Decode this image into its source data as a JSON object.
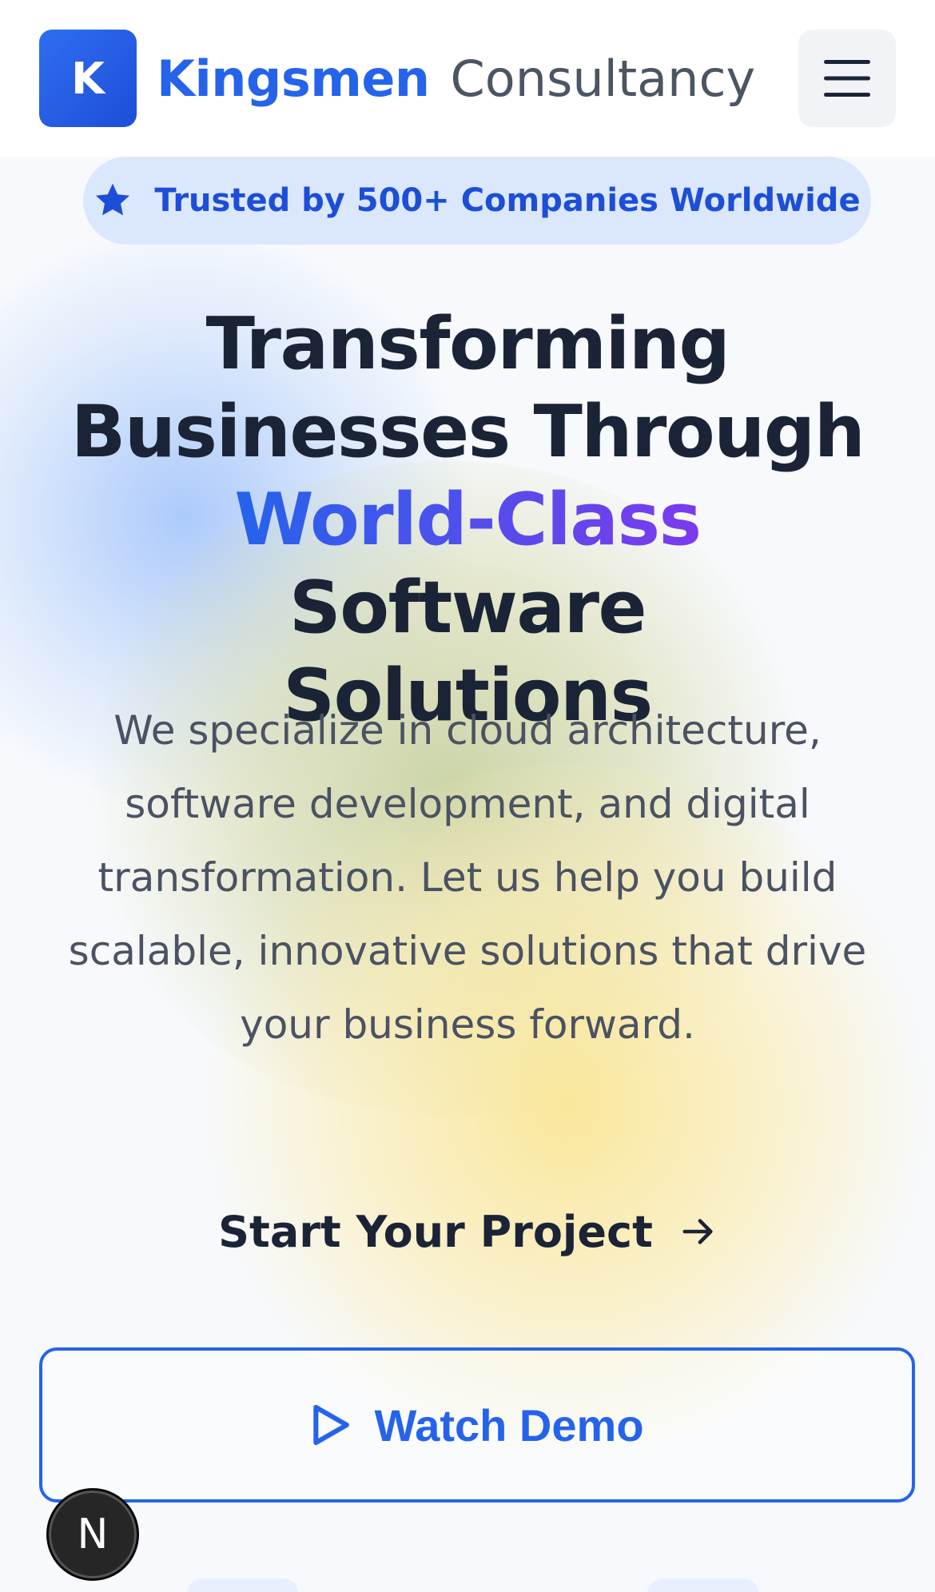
{
  "header": {
    "logo_letter": "K",
    "brand_primary": "Kingsmen",
    "brand_secondary": "Consultancy",
    "menu_icon": "hamburger-menu-icon"
  },
  "hero": {
    "badge": {
      "icon": "star-icon",
      "text": "Trusted by 500+ Companies Worldwide"
    },
    "headline": {
      "line1": "Transforming",
      "line2": "Businesses Through",
      "highlight": "World-Class",
      "line3_rest": "Software",
      "line4": "Solutions"
    },
    "description": "We specialize in cloud architecture, software development, and digital transformation. Let us help you build scalable, innovative solutions that drive your business forward.",
    "cta": {
      "label": "Start Your Project",
      "icon": "arrow-right-icon"
    },
    "demo": {
      "label": "Watch Demo",
      "icon": "play-icon"
    }
  },
  "floating_badge": {
    "letter": "N"
  },
  "colors": {
    "brand_blue": "#2563eb",
    "gradient_end": "#7c3aed",
    "heading": "#1b2436",
    "body_text": "#4a5263",
    "badge_bg": "#dbe7fc"
  }
}
